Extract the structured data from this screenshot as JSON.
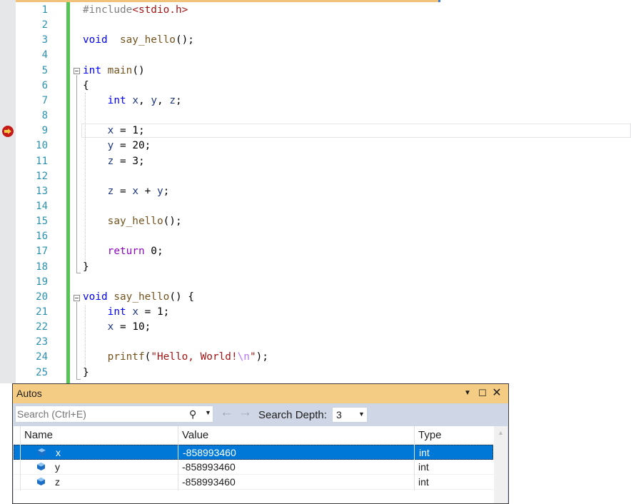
{
  "editor": {
    "lines": [
      {
        "n": "1",
        "tokens": [
          [
            "pp",
            "#include"
          ],
          [
            "inc",
            "<stdio.h>"
          ]
        ]
      },
      {
        "n": "2",
        "tokens": []
      },
      {
        "n": "3",
        "tokens": [
          [
            "kw",
            "void"
          ],
          [
            "",
            "  "
          ],
          [
            "fn",
            "say_hello"
          ],
          [
            "",
            "();"
          ]
        ]
      },
      {
        "n": "4",
        "tokens": []
      },
      {
        "n": "5",
        "tokens": [
          [
            "kw",
            "int"
          ],
          [
            "",
            " "
          ],
          [
            "fn",
            "main"
          ],
          [
            "",
            "()"
          ]
        ]
      },
      {
        "n": "6",
        "tokens": [
          [
            "",
            "{"
          ]
        ]
      },
      {
        "n": "7",
        "tokens": [
          [
            "",
            "    "
          ],
          [
            "kw",
            "int"
          ],
          [
            "",
            " "
          ],
          [
            "var",
            "x"
          ],
          [
            "",
            ", "
          ],
          [
            "var",
            "y"
          ],
          [
            "",
            ", "
          ],
          [
            "var",
            "z"
          ],
          [
            "",
            ";"
          ]
        ]
      },
      {
        "n": "8",
        "tokens": []
      },
      {
        "n": "9",
        "tokens": [
          [
            "",
            "    "
          ],
          [
            "var",
            "x"
          ],
          [
            "",
            " = 1;"
          ]
        ]
      },
      {
        "n": "10",
        "tokens": [
          [
            "",
            "    "
          ],
          [
            "var",
            "y"
          ],
          [
            "",
            " = 20;"
          ]
        ]
      },
      {
        "n": "11",
        "tokens": [
          [
            "",
            "    "
          ],
          [
            "var",
            "z"
          ],
          [
            "",
            " = 3;"
          ]
        ]
      },
      {
        "n": "12",
        "tokens": []
      },
      {
        "n": "13",
        "tokens": [
          [
            "",
            "    "
          ],
          [
            "var",
            "z"
          ],
          [
            "",
            " = "
          ],
          [
            "var",
            "x"
          ],
          [
            "",
            " + "
          ],
          [
            "var",
            "y"
          ],
          [
            "",
            ";"
          ]
        ]
      },
      {
        "n": "14",
        "tokens": []
      },
      {
        "n": "15",
        "tokens": [
          [
            "",
            "    "
          ],
          [
            "fn",
            "say_hello"
          ],
          [
            "",
            "();"
          ]
        ]
      },
      {
        "n": "16",
        "tokens": []
      },
      {
        "n": "17",
        "tokens": [
          [
            "",
            "    "
          ],
          [
            "ret",
            "return"
          ],
          [
            "",
            " 0;"
          ]
        ]
      },
      {
        "n": "18",
        "tokens": [
          [
            "",
            "}"
          ]
        ]
      },
      {
        "n": "19",
        "tokens": []
      },
      {
        "n": "20",
        "tokens": [
          [
            "kw",
            "void"
          ],
          [
            "",
            " "
          ],
          [
            "fn",
            "say_hello"
          ],
          [
            "",
            "() {"
          ]
        ]
      },
      {
        "n": "21",
        "tokens": [
          [
            "",
            "    "
          ],
          [
            "kw",
            "int"
          ],
          [
            "",
            " "
          ],
          [
            "var",
            "x"
          ],
          [
            "",
            " = 1;"
          ]
        ]
      },
      {
        "n": "22",
        "tokens": [
          [
            "",
            "    "
          ],
          [
            "var",
            "x"
          ],
          [
            "",
            " = 10;"
          ]
        ]
      },
      {
        "n": "23",
        "tokens": []
      },
      {
        "n": "24",
        "tokens": [
          [
            "",
            "    "
          ],
          [
            "fn",
            "printf"
          ],
          [
            "",
            "("
          ],
          [
            "str",
            "\"Hello, World!"
          ],
          [
            "esc",
            "\\n"
          ],
          [
            "str",
            "\""
          ],
          [
            "",
            ");"
          ]
        ]
      },
      {
        "n": "25",
        "tokens": [
          [
            "",
            "}"
          ]
        ]
      }
    ],
    "current_line": "9",
    "breakpoint_icon": "breakpoint-arrow-icon"
  },
  "autos": {
    "title": "Autos",
    "search_placeholder": "Search (Ctrl+E)",
    "search_depth_label": "Search Depth:",
    "search_depth_value": "3",
    "columns": [
      "Name",
      "Value",
      "Type"
    ],
    "rows": [
      {
        "name": "x",
        "value": "-858993460",
        "type": "int",
        "selected": true
      },
      {
        "name": "y",
        "value": "-858993460",
        "type": "int",
        "selected": false
      },
      {
        "name": "z",
        "value": "-858993460",
        "type": "int",
        "selected": false
      }
    ],
    "colors": {
      "title_bar": "#f5cc84",
      "selection": "#0078d7",
      "variable_icon": "#1c6fc5"
    }
  }
}
